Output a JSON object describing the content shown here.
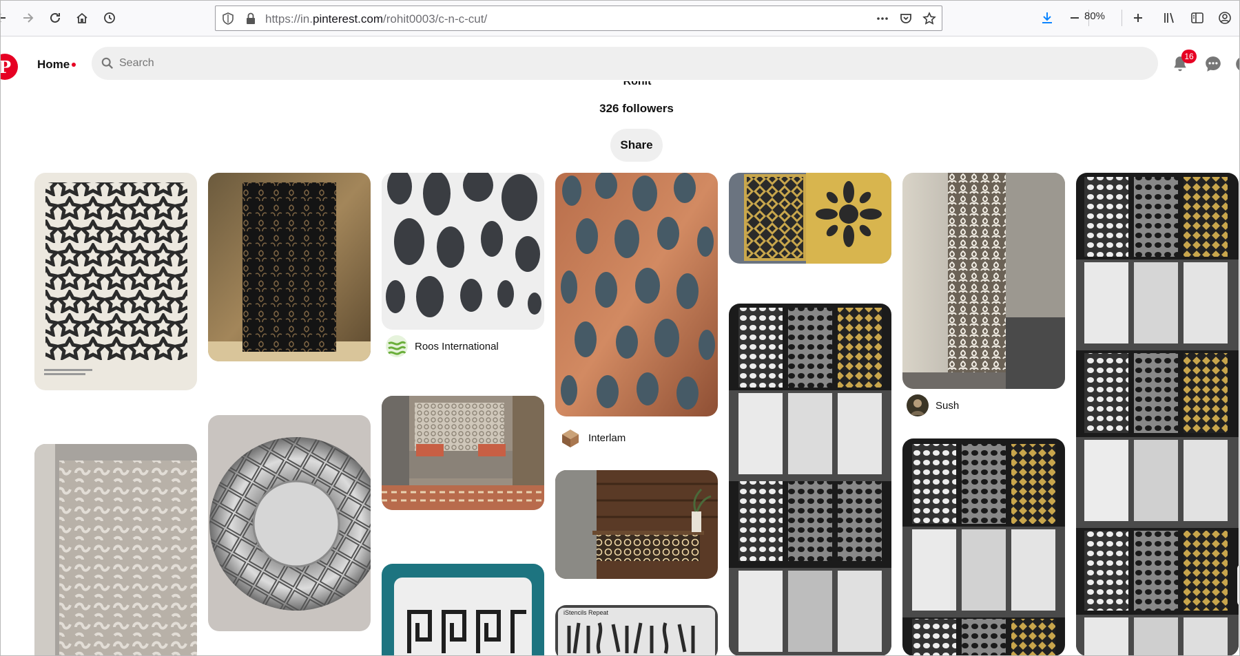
{
  "browser": {
    "url_prefix": "https://in.",
    "url_host": "pinterest.com",
    "url_path": "/rohit0003/c-n-c-cut/",
    "zoom": "80%",
    "icons": [
      "back-icon",
      "forward-icon",
      "reload-icon",
      "home-icon",
      "history-icon",
      "shield-icon",
      "lock-icon",
      "more-icon",
      "pocket-icon",
      "star-icon",
      "download-icon",
      "zoom-out-icon",
      "zoom-in-icon",
      "library-icon",
      "sidebar-icon",
      "account-icon"
    ]
  },
  "header": {
    "logo": "P",
    "home_label": "Home",
    "search_placeholder": "Search",
    "notification_count": "16"
  },
  "board": {
    "owner_name": "Rohit",
    "followers": "326 followers",
    "share_label": "Share"
  },
  "pins": [
    {
      "id": "geometric-stars",
      "source": ""
    },
    {
      "id": "black-floral-panel",
      "source": ""
    },
    {
      "id": "white-organic-holes",
      "source": "Roos International"
    },
    {
      "id": "copper-organic-wall",
      "source": "Interlam"
    },
    {
      "id": "gold-panels",
      "source": ""
    },
    {
      "id": "white-floral-partition",
      "source": "Sush"
    },
    {
      "id": "panel-grid-tall",
      "source": ""
    },
    {
      "id": "scroll-wall-panel",
      "source": ""
    },
    {
      "id": "mirror-sunburst",
      "source": ""
    },
    {
      "id": "bedroom-screen",
      "source": ""
    },
    {
      "id": "panel-grid-middle",
      "source": ""
    },
    {
      "id": "wood-counter",
      "source": ""
    },
    {
      "id": "panel-grid-right",
      "source": ""
    },
    {
      "id": "greek-key-stencil",
      "source": ""
    },
    {
      "id": "stencil-repeat",
      "source": "iStencils Repeat"
    }
  ],
  "colors": {
    "pinterest_red": "#e60023",
    "search_bg": "#efefef",
    "text": "#111111"
  }
}
